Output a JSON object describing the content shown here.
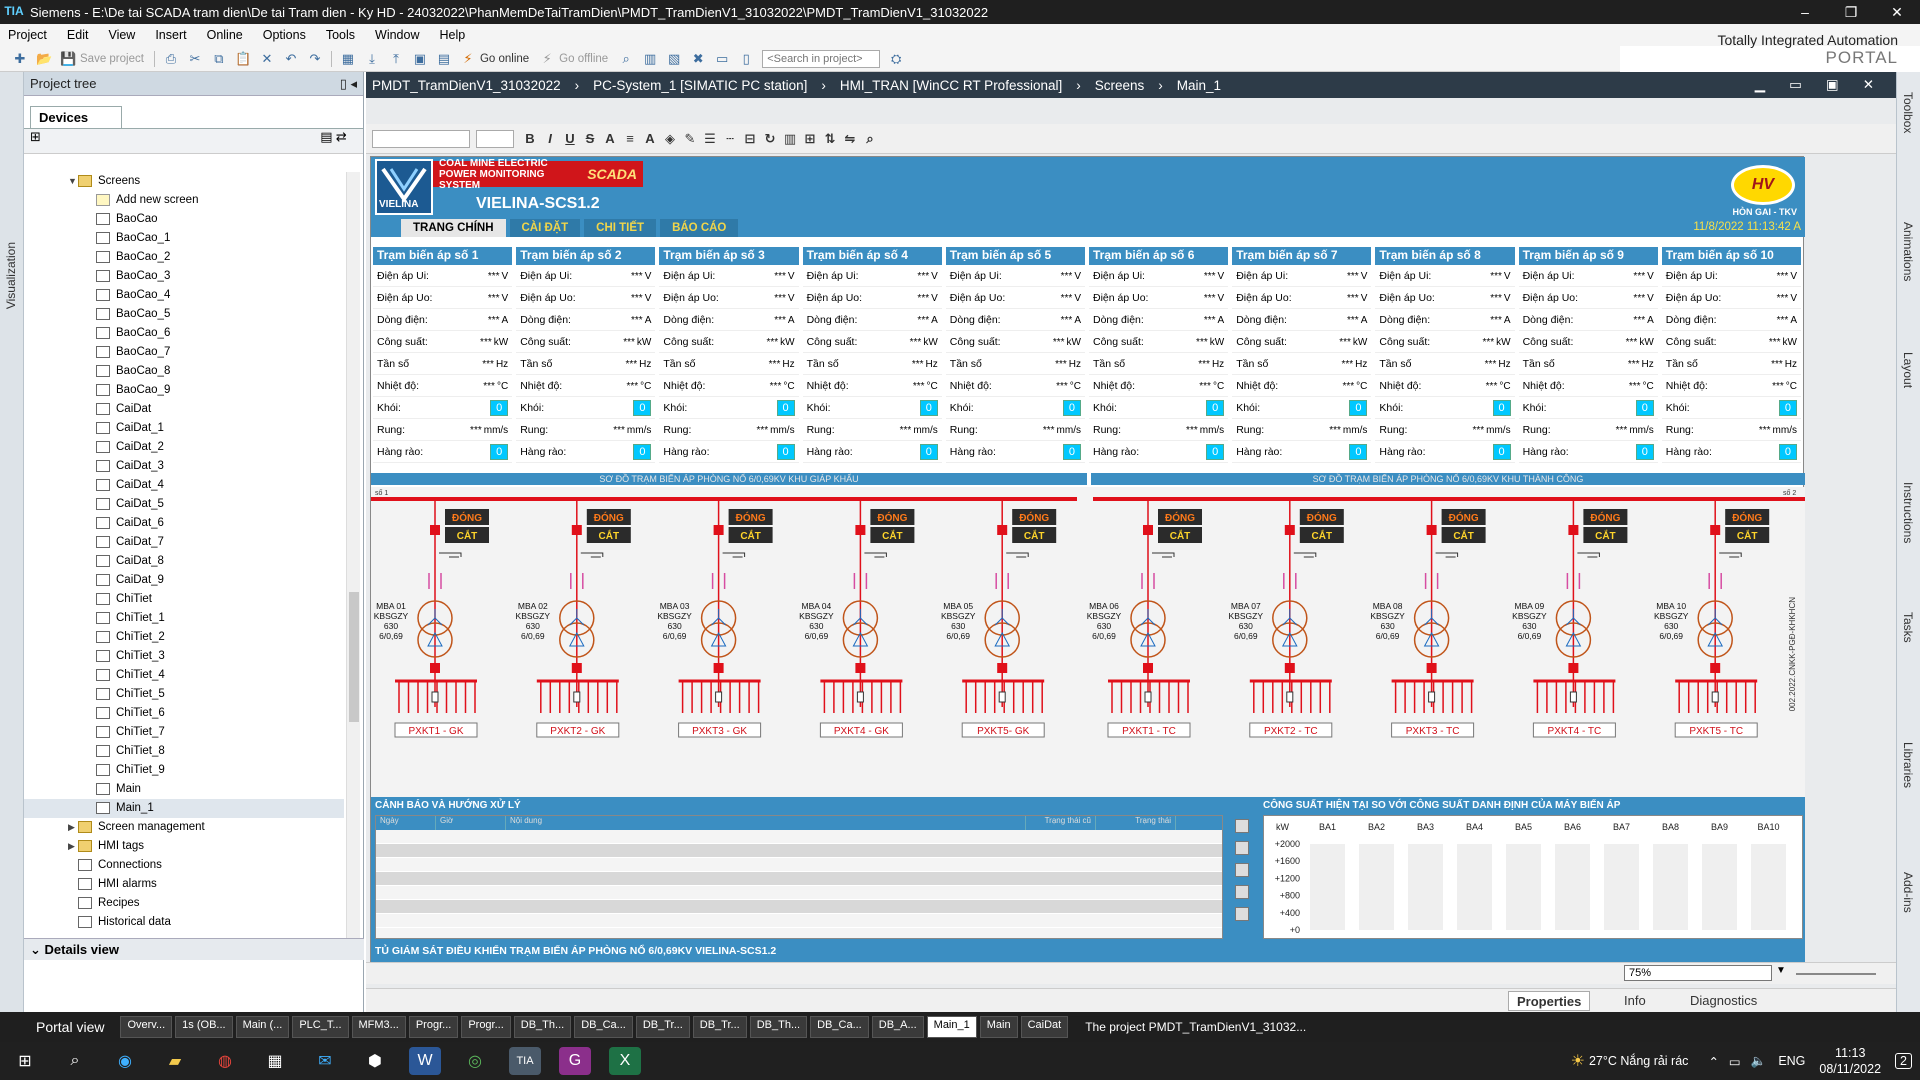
{
  "window": {
    "app": "Siemens",
    "path": "E:\\De tai SCADA tram dien\\De tai Tram dien - Ky HD - 24032022\\PhanMemDeTaiTramDien\\PMDT_TramDienV1_31032022\\PMDT_TramDienV1_31032022"
  },
  "menu": [
    "Project",
    "Edit",
    "View",
    "Insert",
    "Online",
    "Options",
    "Tools",
    "Window",
    "Help"
  ],
  "brand": {
    "line1": "Totally Integrated Automation",
    "line2": "PORTAL"
  },
  "toolbar": {
    "save": "Save project",
    "go_online": "Go online",
    "go_offline": "Go offline",
    "search_placeholder": "<Search in project>"
  },
  "left_strip": "Visualization",
  "project_tree": {
    "title": "Project tree",
    "tab": "Devices",
    "details": "Details view",
    "items": [
      {
        "label": "Screens",
        "level": 1,
        "type": "folder",
        "open": true
      },
      {
        "label": "Add new screen",
        "level": 2,
        "type": "add"
      },
      {
        "label": "BaoCao",
        "level": 2
      },
      {
        "label": "BaoCao_1",
        "level": 2
      },
      {
        "label": "BaoCao_2",
        "level": 2
      },
      {
        "label": "BaoCao_3",
        "level": 2
      },
      {
        "label": "BaoCao_4",
        "level": 2
      },
      {
        "label": "BaoCao_5",
        "level": 2
      },
      {
        "label": "BaoCao_6",
        "level": 2
      },
      {
        "label": "BaoCao_7",
        "level": 2
      },
      {
        "label": "BaoCao_8",
        "level": 2
      },
      {
        "label": "BaoCao_9",
        "level": 2
      },
      {
        "label": "CaiDat",
        "level": 2
      },
      {
        "label": "CaiDat_1",
        "level": 2
      },
      {
        "label": "CaiDat_2",
        "level": 2
      },
      {
        "label": "CaiDat_3",
        "level": 2
      },
      {
        "label": "CaiDat_4",
        "level": 2
      },
      {
        "label": "CaiDat_5",
        "level": 2
      },
      {
        "label": "CaiDat_6",
        "level": 2
      },
      {
        "label": "CaiDat_7",
        "level": 2
      },
      {
        "label": "CaiDat_8",
        "level": 2
      },
      {
        "label": "CaiDat_9",
        "level": 2
      },
      {
        "label": "ChiTiet",
        "level": 2
      },
      {
        "label": "ChiTiet_1",
        "level": 2
      },
      {
        "label": "ChiTiet_2",
        "level": 2
      },
      {
        "label": "ChiTiet_3",
        "level": 2
      },
      {
        "label": "ChiTiet_4",
        "level": 2
      },
      {
        "label": "ChiTiet_5",
        "level": 2
      },
      {
        "label": "ChiTiet_6",
        "level": 2
      },
      {
        "label": "ChiTiet_7",
        "level": 2
      },
      {
        "label": "ChiTiet_8",
        "level": 2
      },
      {
        "label": "ChiTiet_9",
        "level": 2
      },
      {
        "label": "Main",
        "level": 2
      },
      {
        "label": "Main_1",
        "level": 2,
        "selected": true
      },
      {
        "label": "Screen management",
        "level": 1,
        "type": "folder"
      },
      {
        "label": "HMI tags",
        "level": 1,
        "type": "folder"
      },
      {
        "label": "Connections",
        "level": 1
      },
      {
        "label": "HMI alarms",
        "level": 1
      },
      {
        "label": "Recipes",
        "level": 1
      },
      {
        "label": "Historical data",
        "level": 1
      }
    ]
  },
  "breadcrumb": [
    "PMDT_TramDienV1_31032022",
    "PC-System_1 [SIMATIC PC station]",
    "HMI_TRAN [WinCC RT Professional]",
    "Screens",
    "Main_1"
  ],
  "right_strip": [
    "Toolbox",
    "Animations",
    "Layout",
    "Instructions",
    "Tasks",
    "Libraries",
    "Add-ins"
  ],
  "hmi": {
    "coal_label": "COAL MINE ELECTRIC POWER MONITORING SYSTEM",
    "scada": "SCADA",
    "logo_text": "VIELINA",
    "title": "VIELINA-SCS1.2",
    "nav": [
      "TRANG CHÍNH",
      "CÀI ĐẶT",
      "CHI TIẾT",
      "BÁO CÁO"
    ],
    "org": "HÒN GAI - TKV",
    "datetime": "11/8/2022 11:13:42 A",
    "row_labels": [
      "Điện áp Ui:",
      "Điện áp Uo:",
      "Dòng điện:",
      "Công suất:",
      "Tần số",
      "Nhiệt độ:",
      "Khói:",
      "Rung:",
      "Hàng rào:"
    ],
    "row_units": [
      "V",
      "V",
      "A",
      "kW",
      "Hz",
      "°C",
      "",
      "mm/s",
      ""
    ],
    "stars": "***",
    "zero": "0",
    "stations": [
      "Trạm biến áp số 1",
      "Trạm biến áp số 2",
      "Trạm biến áp số 3",
      "Trạm biến áp số 4",
      "Trạm biến áp số 5",
      "Trạm biến áp số 6",
      "Trạm biến áp số 7",
      "Trạm biến áp số 8",
      "Trạm biến áp số 9",
      "Trạm biến áp số 10"
    ],
    "diagram_left": "SƠ ĐỒ TRẠM BIẾN ÁP PHÒNG NỔ 6/0,69KV KHU GIÁP KHẨU",
    "diagram_right": "SƠ ĐỒ TRẠM BIẾN ÁP PHÒNG NỔ 6/0,69KV KHU THÀNH CÔNG",
    "bus_left": "số 1",
    "bus_right": "số 2",
    "dong": "ĐÓNG",
    "cat": "CẮT",
    "mba": [
      "MBA 01",
      "MBA 02",
      "MBA 03",
      "MBA 04",
      "MBA 05",
      "MBA 06",
      "MBA 07",
      "MBA 08",
      "MBA 09",
      "MBA 10"
    ],
    "mba_type": "KBSGZY",
    "mba_power": "630",
    "mba_ratio": "6/0,69",
    "feeders": [
      "PXKT1 - GK",
      "PXKT2 - GK",
      "PXKT3 - GK",
      "PXKT4 - GK",
      "PXKT5- GK",
      "PXKT1 - TC",
      "PXKT2 - TC",
      "PXKT3 - TC",
      "PXKT4 - TC",
      "PXKT5 - TC"
    ],
    "side_code": "002.2022.CNKK-PGĐ-KHKHCN",
    "warn_title": "CẢNH BÁO VÀ HƯỚNG XỬ LÝ",
    "warn_cols": [
      "Ngày",
      "Giờ",
      "Nội dung",
      "Trạng thái cũ",
      "Trạng thái"
    ],
    "power_title": "CÔNG SUẤT HIỆN TẠI SO VỚI CÔNG SUẤT DANH ĐỊNH CỦA MÁY BIẾN ÁP",
    "footer": "TỦ GIÁM SÁT ĐIỀU KHIỂN TRẠM BIẾN ÁP PHÒNG NỔ 6/0,69KV VIELINA-SCS1.2"
  },
  "chart_data": {
    "type": "bar",
    "title": "CÔNG SUẤT HIỆN TẠI SO VỚI CÔNG SUẤT DANH ĐỊNH CỦA MÁY BIẾN ÁP",
    "ylabel": "kW",
    "categories": [
      "BA1",
      "BA2",
      "BA3",
      "BA4",
      "BA5",
      "BA6",
      "BA7",
      "BA8",
      "BA9",
      "BA10"
    ],
    "values": [
      0,
      0,
      0,
      0,
      0,
      0,
      0,
      0,
      0,
      0
    ],
    "yticks": [
      "+0",
      "+400",
      "+800",
      "+1200",
      "+1600",
      "+2000"
    ],
    "ylim": [
      0,
      2000
    ]
  },
  "zoom": "75%",
  "props_tabs": [
    "Properties",
    "Info",
    "Diagnostics"
  ],
  "portal": {
    "label": "Portal view",
    "tasks": [
      "Overv...",
      "1s (OB...",
      "Main (...",
      "PLC_T...",
      "MFM3...",
      "Progr...",
      "Progr...",
      "DB_Th...",
      "DB_Ca...",
      "DB_Tr...",
      "DB_Tr...",
      "DB_Th...",
      "DB_Ca...",
      "DB_A...",
      "Main_1",
      "Main",
      "CaiDat"
    ],
    "status": "The project PMDT_TramDienV1_31032..."
  },
  "taskbar": {
    "weather": "27°C  Nắng rải rác",
    "lang": "ENG",
    "time": "11:13",
    "date": "08/11/2022",
    "notif": "2"
  }
}
